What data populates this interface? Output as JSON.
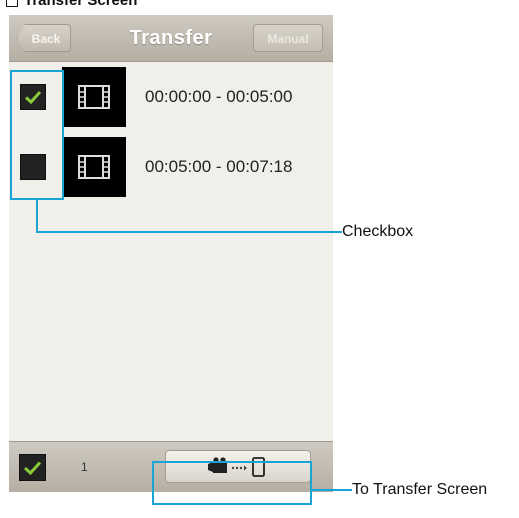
{
  "page_heading": "Transfer Screen",
  "header": {
    "back_label": "Back",
    "title": "Transfer",
    "manual_label": "Manual"
  },
  "rows": [
    {
      "checked": true,
      "thumb_icon": "film-icon",
      "time_range": "00:00:00 - 00:05:00"
    },
    {
      "checked": false,
      "thumb_icon": "film-icon",
      "time_range": "00:05:00 - 00:07:18"
    }
  ],
  "footer": {
    "select_all_checked": true,
    "selected_count": "1",
    "transfer_icons": [
      "camcorder-icon",
      "dots-icon",
      "phone-icon"
    ]
  },
  "callouts": {
    "checkbox_label": "Checkbox",
    "transfer_label": "To Transfer Screen"
  },
  "colors": {
    "accent": "#1aa4d4",
    "check": "#8acb3c",
    "header": "#bfb9ae",
    "body": "#f1efea"
  }
}
